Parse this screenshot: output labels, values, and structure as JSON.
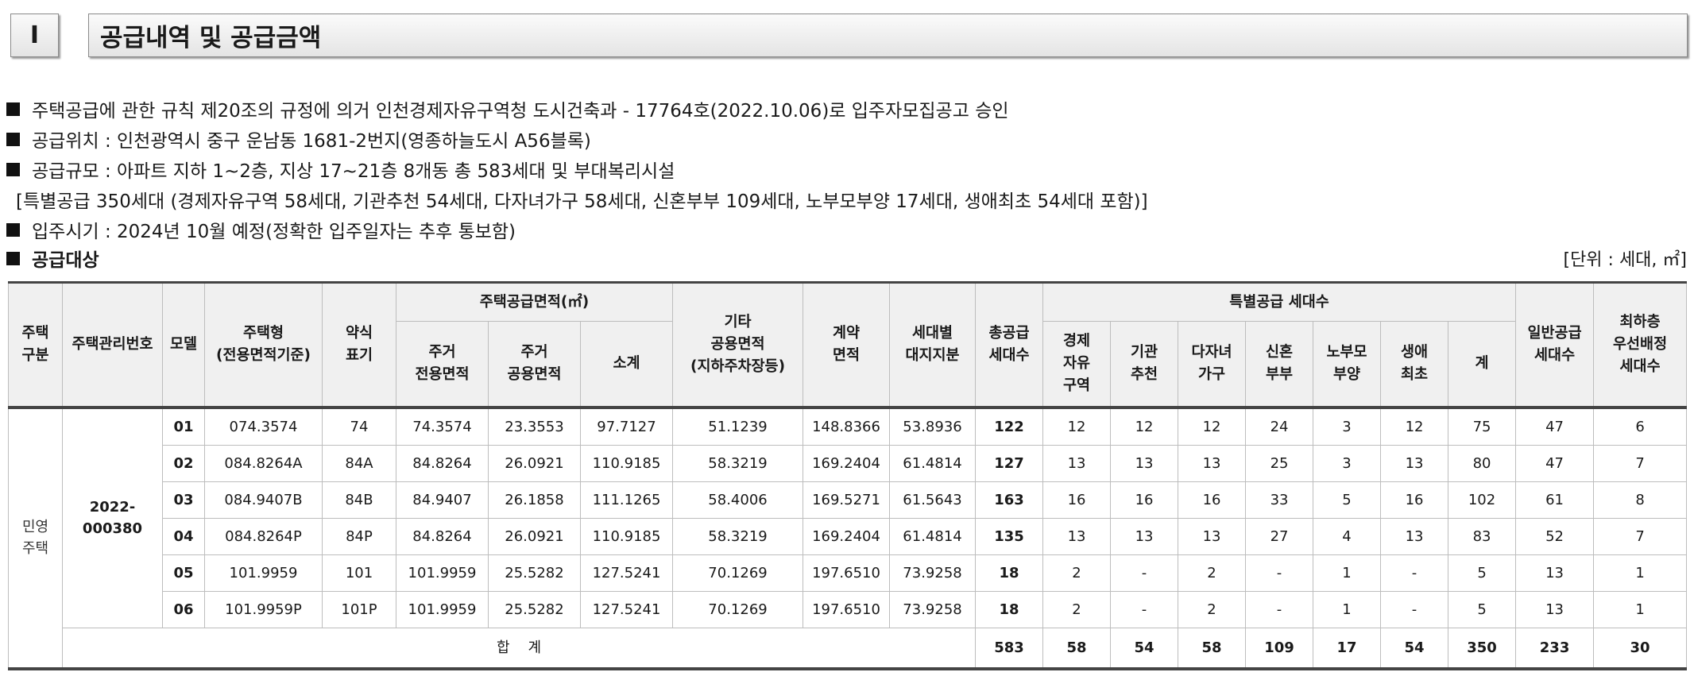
{
  "section": {
    "number": "I",
    "title": "공급내역 및 공급금액"
  },
  "notes": [
    "주택공급에 관한 규칙 제20조의 규정에 의거 인천경제자유구역청 도시건축과 - 17764호(2022.10.06)로 입주자모집공고 승인",
    "공급위치 : 인천광역시 중구 운남동 1681-2번지(영종하늘도시 A56블록)",
    "공급규모 : 아파트 지하 1~2층, 지상 17~21층 8개동 총 583세대 및 부대복리시설",
    "[특별공급 350세대 (경제자유구역 58세대, 기관추천 54세대, 다자녀가구 58세대, 신혼부부 109세대, 노부모부양 17세대, 생애최초 54세대 포함)]",
    "입주시기 : 2024년 10월 예정(정확한 입주일자는 추후 통보함)"
  ],
  "target": {
    "label": "공급대상",
    "unit": "[단위 : 세대, ㎡]"
  },
  "table": {
    "headers": {
      "housing_type": "주택\n구분",
      "mgmt_no": "주택관리번호",
      "model": "모델",
      "house_type": "주택형\n(전용면적기준)",
      "abbr": "약식\n표기",
      "area_group": "주택공급면적(㎡)",
      "excl": "주거\n전용면적",
      "common": "주거\n공용면적",
      "subtotal": "소계",
      "other": "기타\n공용면적\n(지하주차장등)",
      "contract": "계약\n면적",
      "land": "세대별\n대지지분",
      "total_supply": "총공급\n세대수",
      "special_group": "특별공급 세대수",
      "sp_econ": "경제\n자유\n구역",
      "sp_inst": "기관\n추천",
      "sp_multi": "다자녀\n가구",
      "sp_newly": "신혼\n부부",
      "sp_elder": "노부모\n부양",
      "sp_first": "생애\n최초",
      "sp_sum": "계",
      "general": "일반공급\n세대수",
      "lowest": "최하층\n우선배정\n세대수"
    },
    "housing_kind": "민영\n주택",
    "mgmt_number": "2022-000380",
    "rows": [
      [
        "01",
        "074.3574",
        "74",
        "74.3574",
        "23.3553",
        "97.7127",
        "51.1239",
        "148.8366",
        "53.8936",
        "122",
        "12",
        "12",
        "12",
        "24",
        "3",
        "12",
        "75",
        "47",
        "6"
      ],
      [
        "02",
        "084.8264A",
        "84A",
        "84.8264",
        "26.0921",
        "110.9185",
        "58.3219",
        "169.2404",
        "61.4814",
        "127",
        "13",
        "13",
        "13",
        "25",
        "3",
        "13",
        "80",
        "47",
        "7"
      ],
      [
        "03",
        "084.9407B",
        "84B",
        "84.9407",
        "26.1858",
        "111.1265",
        "58.4006",
        "169.5271",
        "61.5643",
        "163",
        "16",
        "16",
        "16",
        "33",
        "5",
        "16",
        "102",
        "61",
        "8"
      ],
      [
        "04",
        "084.8264P",
        "84P",
        "84.8264",
        "26.0921",
        "110.9185",
        "58.3219",
        "169.2404",
        "61.4814",
        "135",
        "13",
        "13",
        "13",
        "27",
        "4",
        "13",
        "83",
        "52",
        "7"
      ],
      [
        "05",
        "101.9959",
        "101",
        "101.9959",
        "25.5282",
        "127.5241",
        "70.1269",
        "197.6510",
        "73.9258",
        "18",
        "2",
        "-",
        "2",
        "-",
        "1",
        "-",
        "5",
        "13",
        "1"
      ],
      [
        "06",
        "101.9959P",
        "101P",
        "101.9959",
        "25.5282",
        "127.5241",
        "70.1269",
        "197.6510",
        "73.9258",
        "18",
        "2",
        "-",
        "2",
        "-",
        "1",
        "-",
        "5",
        "13",
        "1"
      ]
    ],
    "total": {
      "label": "합    계",
      "values": [
        "583",
        "58",
        "54",
        "58",
        "109",
        "17",
        "54",
        "350",
        "233",
        "30"
      ]
    }
  }
}
